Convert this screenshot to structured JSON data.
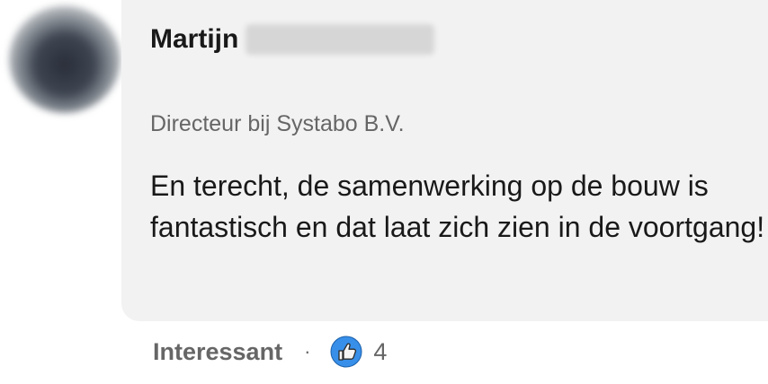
{
  "comment": {
    "author_name": "Martijn",
    "author_headline": "Directeur bij Systabo B.V.",
    "text": "En terecht, de samenwerking op de bouw is fantastisch en dat laat zich zien in de voortgang!"
  },
  "actions": {
    "reaction_label": "Interessant",
    "separator": "·",
    "reaction_icon": "like-icon",
    "reaction_count": "4"
  },
  "colors": {
    "bubble": "#f2f2f2",
    "like_blue": "#378fe9",
    "text_primary": "#191919",
    "text_secondary": "#666666"
  }
}
